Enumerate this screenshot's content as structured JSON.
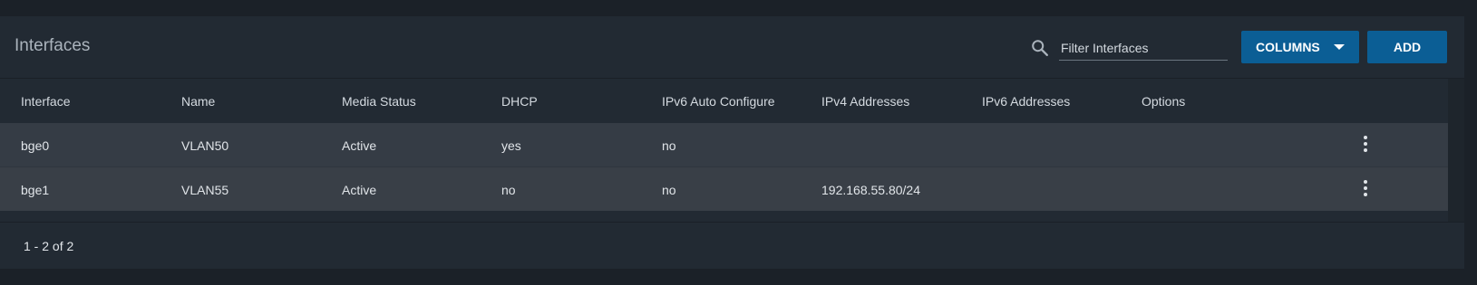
{
  "header": {
    "title": "Interfaces",
    "filter_placeholder": "Filter Interfaces",
    "filter_value": "",
    "columns_label": "COLUMNS",
    "add_label": "ADD"
  },
  "table": {
    "columns": [
      "Interface",
      "Name",
      "Media Status",
      "DHCP",
      "IPv6 Auto Configure",
      "IPv4 Addresses",
      "IPv6 Addresses",
      "Options"
    ],
    "rows": [
      {
        "interface": "bge0",
        "name": "VLAN50",
        "media_status": "Active",
        "dhcp": "yes",
        "ipv6_auto": "no",
        "ipv4": "",
        "ipv6": ""
      },
      {
        "interface": "bge1",
        "name": "VLAN55",
        "media_status": "Active",
        "dhcp": "no",
        "ipv6_auto": "no",
        "ipv4": "192.168.55.80/24",
        "ipv6": ""
      }
    ]
  },
  "footer": {
    "pagination": "1 - 2 of 2"
  },
  "icons": {
    "search": "search-icon",
    "row_menu": "more-vertical-icon",
    "columns_caret": "caret-down-icon"
  },
  "colors": {
    "accent": "#0b5e95",
    "background": "#1b2128",
    "card": "#222a33",
    "row": "#353c45"
  }
}
